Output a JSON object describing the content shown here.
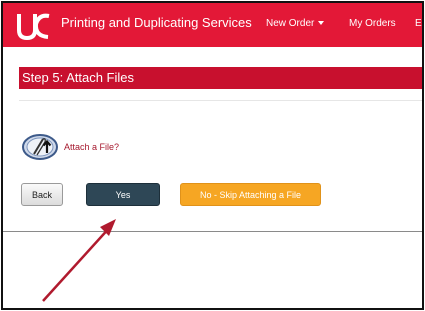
{
  "header": {
    "brand": "Printing and Duplicating Services",
    "nav": {
      "new_order": "New Order",
      "my_orders": "My Orders",
      "more": "E"
    }
  },
  "step": {
    "title": "Step 5: Attach Files"
  },
  "attach": {
    "link": "Attach a File?",
    "icon": "attach-file-icon"
  },
  "buttons": {
    "back": "Back",
    "yes": "Yes",
    "skip": "No - Skip Attaching a File"
  },
  "colors": {
    "brand_red": "#e31837",
    "step_red": "#c8102e",
    "yes_button": "#2e4756",
    "skip_button": "#f6a623",
    "annotation_arrow": "#b01a2e"
  }
}
